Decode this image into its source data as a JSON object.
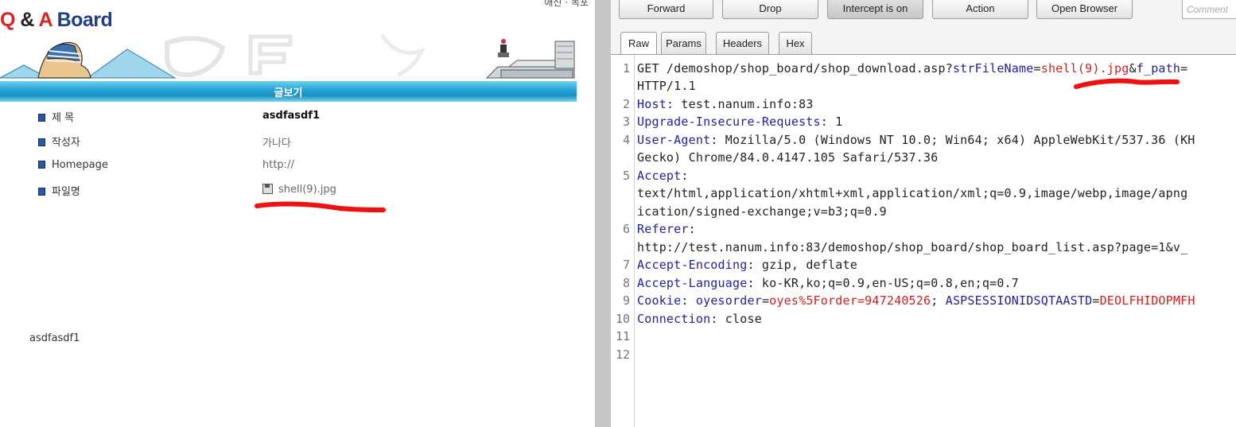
{
  "webpage": {
    "top_nav": "애신 · 목포",
    "board_title": {
      "q": "Q",
      "amp": " & ",
      "a": "A",
      "rest": " Board"
    },
    "bar_label": "글보기",
    "fields": [
      {
        "label": "제 목",
        "value": "asdfasdf1"
      },
      {
        "label": "작성자",
        "value": "가나다"
      },
      {
        "label": "Homepage",
        "value": "http://"
      },
      {
        "label": "파일명",
        "value": "shell(9).jpg"
      }
    ],
    "content": "asdfasdf1"
  },
  "proxy": {
    "toolbar": {
      "forward": "Forward",
      "drop": "Drop",
      "intercept": "Intercept is on",
      "action": "Action",
      "open_browser": "Open Browser",
      "comment_placeholder": "Comment"
    },
    "tabs": [
      "Raw",
      "Params",
      "Headers",
      "Hex"
    ],
    "active_tab": "Raw",
    "line_numbers": [
      "1",
      "2",
      "3",
      "4",
      "5",
      "6",
      "7",
      "8",
      "9",
      "10",
      "11",
      "12"
    ],
    "request": {
      "l1_method": "GET /demoshop/shop_board/shop_download.asp?",
      "l1_param1_name": "strFileName",
      "l1_eq1": "=",
      "l1_param1_value": "shell(9).jpg",
      "l1_amp": "&",
      "l1_param2_name": "f_path",
      "l1_eq2": "=",
      "l1_param2_value": "",
      "l1_cont": "HTTP/1.1",
      "host_name": "Host",
      "host_value": ": test.nanum.info:83",
      "uir_name": "Upgrade-Insecure-Requests",
      "uir_value": ": 1",
      "ua_name": "User-Agent",
      "ua_value": ": Mozilla/5.0 (Windows NT 10.0; Win64; x64) AppleWebKit/537.36 (KH",
      "ua_cont": "Gecko) Chrome/84.0.4147.105 Safari/537.36",
      "accept_name": "Accept",
      "accept_value": ":",
      "accept_cont1": "text/html,application/xhtml+xml,application/xml;q=0.9,image/webp,image/apng",
      "accept_cont2": "ication/signed-exchange;v=b3;q=0.9",
      "referer_name": "Referer",
      "referer_value": ":",
      "referer_cont": "http://test.nanum.info:83/demoshop/shop_board/shop_board_list.asp?page=1&v_",
      "ae_name": "Accept-Encoding",
      "ae_value": ": gzip, deflate",
      "al_name": "Accept-Language",
      "al_value": ": ko-KR,ko;q=0.9,en-US;q=0.8,en;q=0.7",
      "cookie_name": "Cookie",
      "cookie_sep": ": ",
      "cookie1_name": "oyesorder",
      "cookie1_eq": "=",
      "cookie1_value": "oyes%5Forder=947240526",
      "cookie_semi": "; ",
      "cookie2_name": "ASPSESSIONIDSQTAASTD",
      "cookie2_eq": "=",
      "cookie2_value": "DEOLFHIDOPMFH",
      "conn_name": "Connection",
      "conn_value": ": close"
    }
  },
  "colors": {
    "header_key": "#1f1fa6",
    "param_value": "#d41f1f",
    "bar": "#21a2d4",
    "annotation": "#ee1111"
  }
}
